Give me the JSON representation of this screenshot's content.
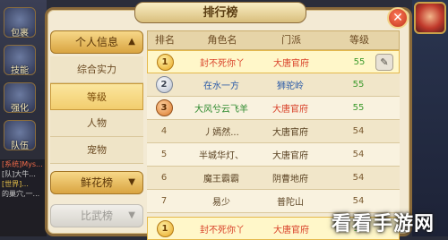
{
  "sidebar_buttons": [
    {
      "label": "包裹"
    },
    {
      "label": "技能"
    },
    {
      "label": "强化"
    },
    {
      "label": "队伍"
    }
  ],
  "chat_lines": [
    "[系统]Mys...",
    "[队]大牛...",
    "[世界]...",
    "的巢穴,一..."
  ],
  "title": "排行榜",
  "close_label": "✕",
  "menu": {
    "category_personal": "个人信息",
    "items": [
      "综合实力",
      "等级",
      "人物",
      "宠物"
    ],
    "active_index": 1,
    "category_flower": "鲜花榜",
    "category_fight": "比武榜"
  },
  "table": {
    "headers": [
      "排名",
      "角色名",
      "门派",
      "等级"
    ],
    "rows": [
      {
        "rank": "1",
        "name": "封不死你丫",
        "sect": "大唐官府",
        "level": "55",
        "medal": "gold",
        "highlight": true
      },
      {
        "rank": "2",
        "name": "在水一方",
        "sect": "狮驼岭",
        "level": "55",
        "medal": "silver"
      },
      {
        "rank": "3",
        "name": "大风兮云飞羊",
        "sect": "大唐官府",
        "level": "55",
        "medal": "bronze"
      },
      {
        "rank": "4",
        "name": "丿嫣然...",
        "sect": "大唐官府",
        "level": "54"
      },
      {
        "rank": "5",
        "name": "半城华灯、",
        "sect": "大唐官府",
        "level": "54"
      },
      {
        "rank": "6",
        "name": "魔王霸霸",
        "sect": "阴曹地府",
        "level": "54"
      },
      {
        "rank": "7",
        "name": "易少",
        "sect": "普陀山",
        "level": "54"
      }
    ],
    "my_row": {
      "rank": "1",
      "name": "封不死你丫",
      "sect": "大唐官府",
      "level": "55"
    }
  },
  "colors": {
    "name_top": "#d9422a",
    "sect_datang": "#d9422a",
    "name_blue": "#2a5aa8",
    "sect_green": "#2f8a2f",
    "level_green": "#3c9a2c",
    "level_plain": "#7a5a30"
  },
  "watermark": "看看手游网"
}
